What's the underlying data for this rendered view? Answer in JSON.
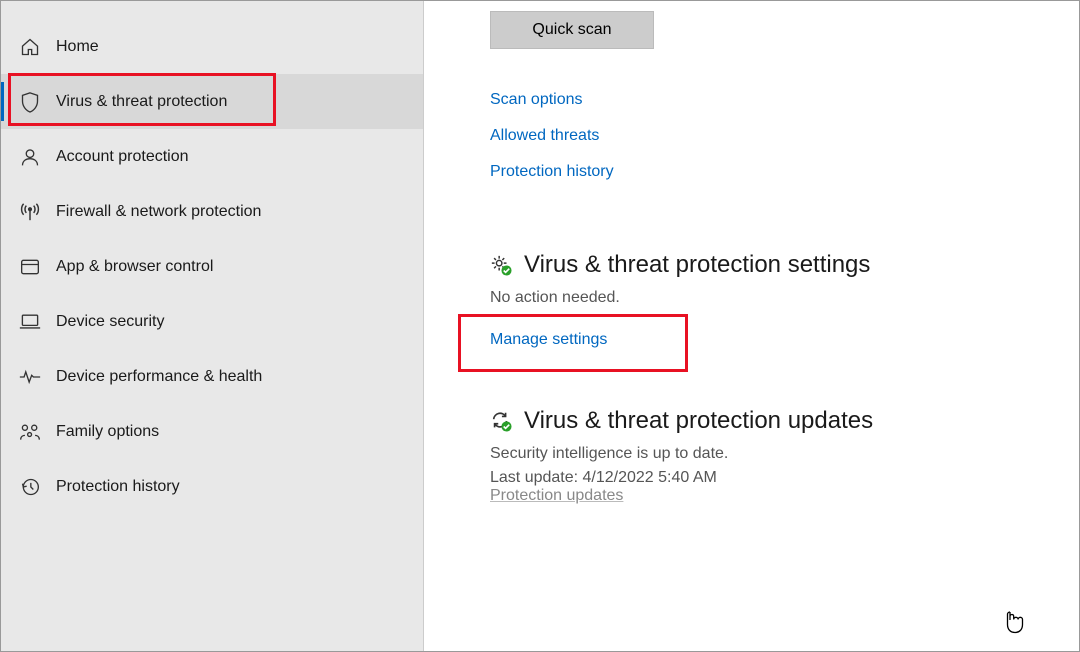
{
  "sidebar": {
    "items": [
      {
        "label": "Home"
      },
      {
        "label": "Virus & threat protection"
      },
      {
        "label": "Account protection"
      },
      {
        "label": "Firewall & network protection"
      },
      {
        "label": "App & browser control"
      },
      {
        "label": "Device security"
      },
      {
        "label": "Device performance & health"
      },
      {
        "label": "Family options"
      },
      {
        "label": "Protection history"
      }
    ]
  },
  "main": {
    "quick_scan": "Quick scan",
    "links": {
      "scan_options": "Scan options",
      "allowed_threats": "Allowed threats",
      "protection_history": "Protection history"
    },
    "settings_section": {
      "title": "Virus & threat protection settings",
      "status": "No action needed.",
      "manage_link": "Manage settings"
    },
    "updates_section": {
      "title": "Virus & threat protection updates",
      "status": "Security intelligence is up to date.",
      "last_update": "Last update: 4/12/2022 5:40 AM",
      "updates_link": "Protection updates"
    }
  }
}
